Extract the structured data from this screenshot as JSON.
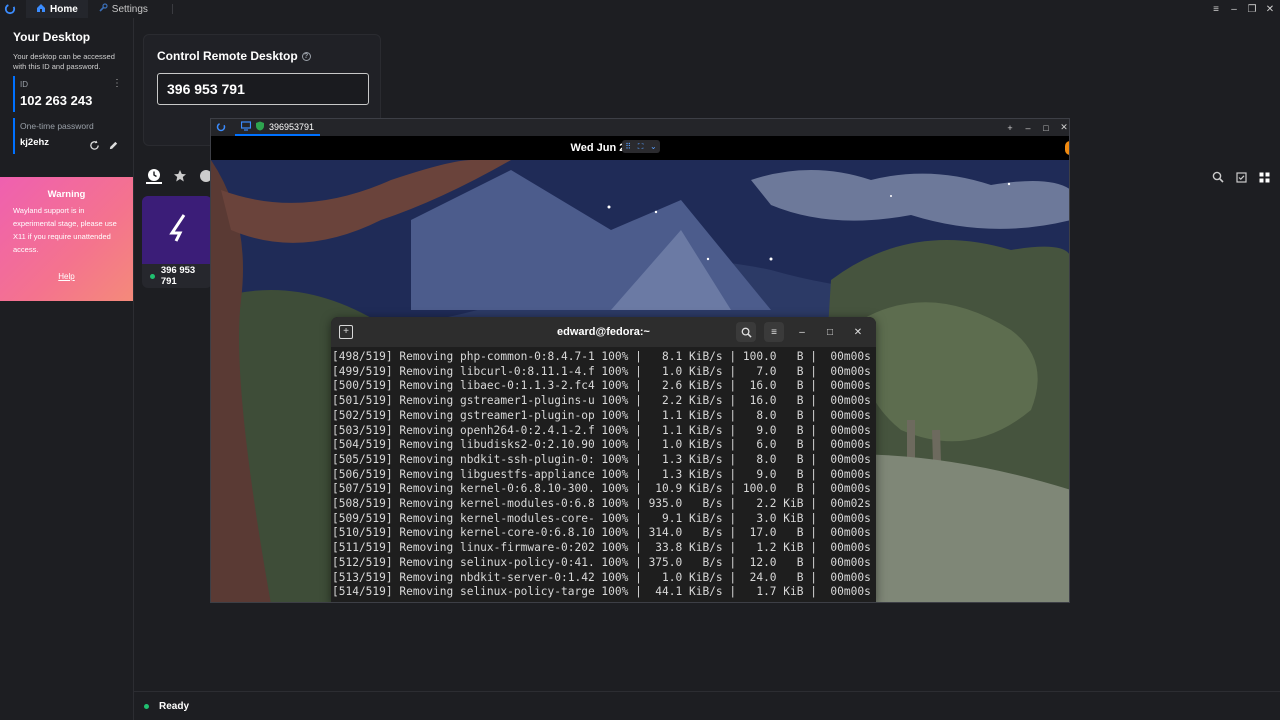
{
  "topbar": {
    "tabs": [
      {
        "label": "Home",
        "icon": "home-icon"
      },
      {
        "label": "Settings",
        "icon": "wrench-icon"
      }
    ]
  },
  "left": {
    "title": "Your Desktop",
    "description": "Your desktop can be accessed with this ID and password.",
    "id_label": "ID",
    "id_value": "102 263 243",
    "password_label": "One-time password",
    "password_value": "kj2ehz",
    "warning": {
      "title": "Warning",
      "text": "Wayland support is in experimental stage, please use X11 if you require unattended access.",
      "help": "Help"
    }
  },
  "control": {
    "title": "Control Remote Desktop",
    "input_value": "396 953 791"
  },
  "peers": [
    {
      "id": "396 953 791",
      "online": true
    }
  ],
  "status": {
    "text": "Ready"
  },
  "remote": {
    "tab_label": "396953791",
    "clock": "Wed Jun 25",
    "terminal": {
      "title": "edward@fedora:~",
      "lines": [
        "[498/519] Removing php-common-0:8.4.7-1 100% |   8.1 KiB/s | 100.0   B |  00m00s",
        "[499/519] Removing libcurl-0:8.11.1-4.f 100% |   1.0 KiB/s |   7.0   B |  00m00s",
        "[500/519] Removing libaec-0:1.1.3-2.fc4 100% |   2.6 KiB/s |  16.0   B |  00m00s",
        "[501/519] Removing gstreamer1-plugins-u 100% |   2.2 KiB/s |  16.0   B |  00m00s",
        "[502/519] Removing gstreamer1-plugin-op 100% |   1.1 KiB/s |   8.0   B |  00m00s",
        "[503/519] Removing openh264-0:2.4.1-2.f 100% |   1.1 KiB/s |   9.0   B |  00m00s",
        "[504/519] Removing libudisks2-0:2.10.90 100% |   1.0 KiB/s |   6.0   B |  00m00s",
        "[505/519] Removing nbdkit-ssh-plugin-0: 100% |   1.3 KiB/s |   8.0   B |  00m00s",
        "[506/519] Removing libguestfs-appliance 100% |   1.3 KiB/s |   9.0   B |  00m00s",
        "[507/519] Removing kernel-0:6.8.10-300. 100% |  10.9 KiB/s | 100.0   B |  00m00s",
        "[508/519] Removing kernel-modules-0:6.8 100% | 935.0   B/s |   2.2 KiB |  00m02s",
        "[509/519] Removing kernel-modules-core- 100% |   9.1 KiB/s |   3.0 KiB |  00m00s",
        "[510/519] Removing kernel-core-0:6.8.10 100% | 314.0   B/s |  17.0   B |  00m00s",
        "[511/519] Removing linux-firmware-0:202 100% |  33.8 KiB/s |   1.2 KiB |  00m00s",
        "[512/519] Removing selinux-policy-0:41. 100% | 375.0   B/s |  12.0   B |  00m00s",
        "[513/519] Removing nbdkit-server-0:1.42 100% |   1.0 KiB/s |  24.0   B |  00m00s",
        "[514/519] Removing selinux-policy-targe 100% |  44.1 KiB/s |   1.7 KiB |  00m00s"
      ]
    }
  },
  "colors": {
    "accent": "#0071ff",
    "online": "#20c070",
    "warning_start": "#ef60b0",
    "warning_end": "#f48a7a"
  }
}
